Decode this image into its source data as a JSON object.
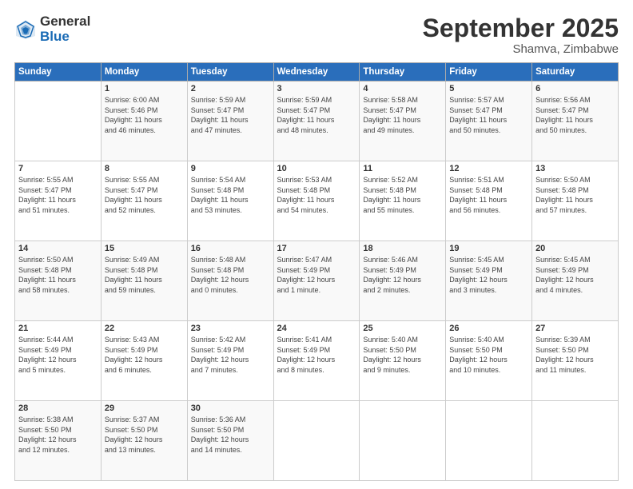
{
  "logo": {
    "general": "General",
    "blue": "Blue"
  },
  "title": "September 2025",
  "location": "Shamva, Zimbabwe",
  "days_of_week": [
    "Sunday",
    "Monday",
    "Tuesday",
    "Wednesday",
    "Thursday",
    "Friday",
    "Saturday"
  ],
  "weeks": [
    [
      {
        "day": "",
        "info": ""
      },
      {
        "day": "1",
        "info": "Sunrise: 6:00 AM\nSunset: 5:46 PM\nDaylight: 11 hours\nand 46 minutes."
      },
      {
        "day": "2",
        "info": "Sunrise: 5:59 AM\nSunset: 5:47 PM\nDaylight: 11 hours\nand 47 minutes."
      },
      {
        "day": "3",
        "info": "Sunrise: 5:59 AM\nSunset: 5:47 PM\nDaylight: 11 hours\nand 48 minutes."
      },
      {
        "day": "4",
        "info": "Sunrise: 5:58 AM\nSunset: 5:47 PM\nDaylight: 11 hours\nand 49 minutes."
      },
      {
        "day": "5",
        "info": "Sunrise: 5:57 AM\nSunset: 5:47 PM\nDaylight: 11 hours\nand 50 minutes."
      },
      {
        "day": "6",
        "info": "Sunrise: 5:56 AM\nSunset: 5:47 PM\nDaylight: 11 hours\nand 50 minutes."
      }
    ],
    [
      {
        "day": "7",
        "info": "Sunrise: 5:55 AM\nSunset: 5:47 PM\nDaylight: 11 hours\nand 51 minutes."
      },
      {
        "day": "8",
        "info": "Sunrise: 5:55 AM\nSunset: 5:47 PM\nDaylight: 11 hours\nand 52 minutes."
      },
      {
        "day": "9",
        "info": "Sunrise: 5:54 AM\nSunset: 5:48 PM\nDaylight: 11 hours\nand 53 minutes."
      },
      {
        "day": "10",
        "info": "Sunrise: 5:53 AM\nSunset: 5:48 PM\nDaylight: 11 hours\nand 54 minutes."
      },
      {
        "day": "11",
        "info": "Sunrise: 5:52 AM\nSunset: 5:48 PM\nDaylight: 11 hours\nand 55 minutes."
      },
      {
        "day": "12",
        "info": "Sunrise: 5:51 AM\nSunset: 5:48 PM\nDaylight: 11 hours\nand 56 minutes."
      },
      {
        "day": "13",
        "info": "Sunrise: 5:50 AM\nSunset: 5:48 PM\nDaylight: 11 hours\nand 57 minutes."
      }
    ],
    [
      {
        "day": "14",
        "info": "Sunrise: 5:50 AM\nSunset: 5:48 PM\nDaylight: 11 hours\nand 58 minutes."
      },
      {
        "day": "15",
        "info": "Sunrise: 5:49 AM\nSunset: 5:48 PM\nDaylight: 11 hours\nand 59 minutes."
      },
      {
        "day": "16",
        "info": "Sunrise: 5:48 AM\nSunset: 5:48 PM\nDaylight: 12 hours\nand 0 minutes."
      },
      {
        "day": "17",
        "info": "Sunrise: 5:47 AM\nSunset: 5:49 PM\nDaylight: 12 hours\nand 1 minute."
      },
      {
        "day": "18",
        "info": "Sunrise: 5:46 AM\nSunset: 5:49 PM\nDaylight: 12 hours\nand 2 minutes."
      },
      {
        "day": "19",
        "info": "Sunrise: 5:45 AM\nSunset: 5:49 PM\nDaylight: 12 hours\nand 3 minutes."
      },
      {
        "day": "20",
        "info": "Sunrise: 5:45 AM\nSunset: 5:49 PM\nDaylight: 12 hours\nand 4 minutes."
      }
    ],
    [
      {
        "day": "21",
        "info": "Sunrise: 5:44 AM\nSunset: 5:49 PM\nDaylight: 12 hours\nand 5 minutes."
      },
      {
        "day": "22",
        "info": "Sunrise: 5:43 AM\nSunset: 5:49 PM\nDaylight: 12 hours\nand 6 minutes."
      },
      {
        "day": "23",
        "info": "Sunrise: 5:42 AM\nSunset: 5:49 PM\nDaylight: 12 hours\nand 7 minutes."
      },
      {
        "day": "24",
        "info": "Sunrise: 5:41 AM\nSunset: 5:49 PM\nDaylight: 12 hours\nand 8 minutes."
      },
      {
        "day": "25",
        "info": "Sunrise: 5:40 AM\nSunset: 5:50 PM\nDaylight: 12 hours\nand 9 minutes."
      },
      {
        "day": "26",
        "info": "Sunrise: 5:40 AM\nSunset: 5:50 PM\nDaylight: 12 hours\nand 10 minutes."
      },
      {
        "day": "27",
        "info": "Sunrise: 5:39 AM\nSunset: 5:50 PM\nDaylight: 12 hours\nand 11 minutes."
      }
    ],
    [
      {
        "day": "28",
        "info": "Sunrise: 5:38 AM\nSunset: 5:50 PM\nDaylight: 12 hours\nand 12 minutes."
      },
      {
        "day": "29",
        "info": "Sunrise: 5:37 AM\nSunset: 5:50 PM\nDaylight: 12 hours\nand 13 minutes."
      },
      {
        "day": "30",
        "info": "Sunrise: 5:36 AM\nSunset: 5:50 PM\nDaylight: 12 hours\nand 14 minutes."
      },
      {
        "day": "",
        "info": ""
      },
      {
        "day": "",
        "info": ""
      },
      {
        "day": "",
        "info": ""
      },
      {
        "day": "",
        "info": ""
      }
    ]
  ]
}
